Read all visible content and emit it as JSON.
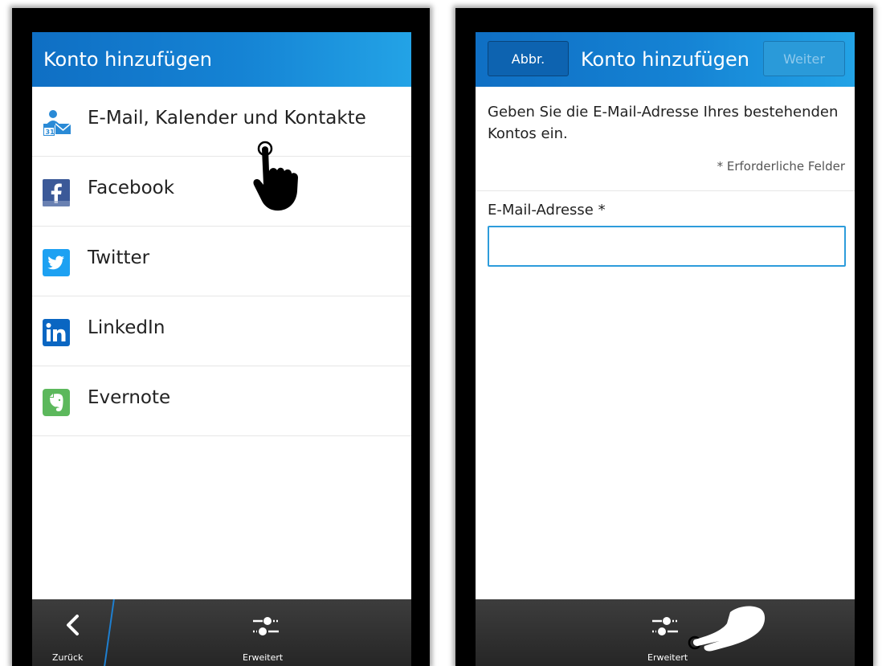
{
  "left": {
    "header": {
      "title": "Konto hinzufügen"
    },
    "accounts": [
      {
        "label": "E-Mail, Kalender und Kontakte",
        "icon": "email-calendar-contacts-icon"
      },
      {
        "label": "Facebook",
        "icon": "facebook-icon"
      },
      {
        "label": "Twitter",
        "icon": "twitter-icon"
      },
      {
        "label": "LinkedIn",
        "icon": "linkedin-icon"
      },
      {
        "label": "Evernote",
        "icon": "evernote-icon"
      }
    ],
    "actionbar": {
      "back_label": "Zurück",
      "advanced_label": "Erweitert"
    }
  },
  "right": {
    "header": {
      "cancel_label": "Abbr.",
      "title": "Konto hinzufügen",
      "next_label": "Weiter"
    },
    "instruction": "Geben Sie die E-Mail-Adresse Ihres bestehenden Kontos ein.",
    "required_note": "* Erforderliche Felder",
    "email_label": "E-Mail-Adresse *",
    "email_value": "",
    "actionbar": {
      "advanced_label": "Erweitert"
    }
  },
  "colors": {
    "header_blue": "#1583d4",
    "input_border": "#2d9cdb",
    "facebook": "#3b5998",
    "twitter": "#1da1f2",
    "linkedin": "#0a66c2",
    "evernote": "#5cb85c"
  }
}
